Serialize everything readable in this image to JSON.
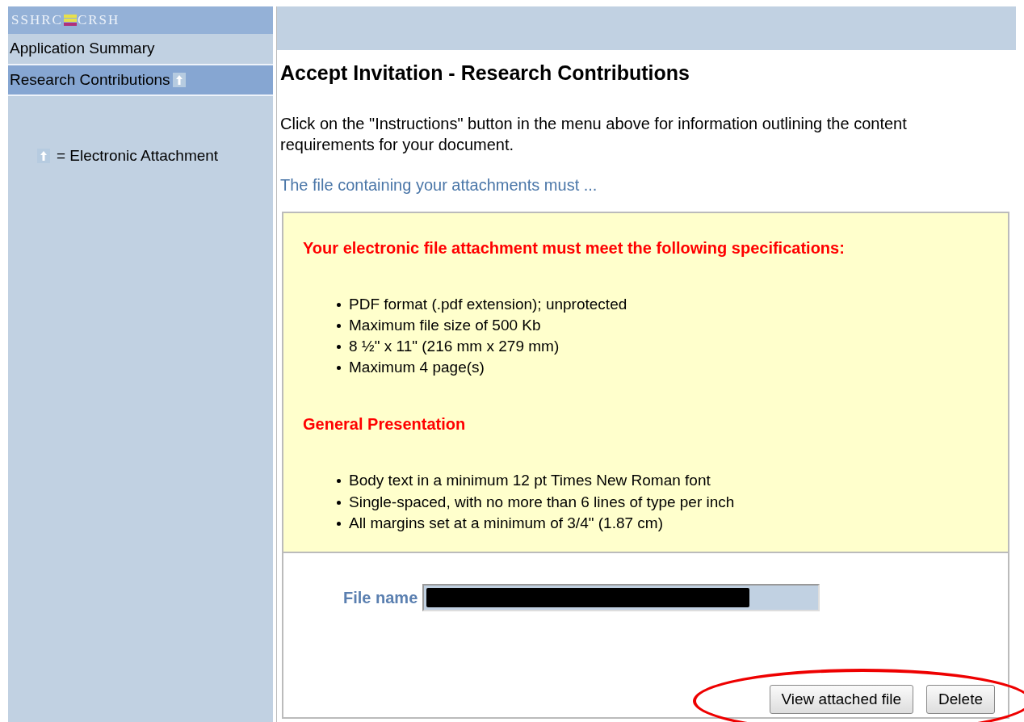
{
  "sidebar": {
    "logo": {
      "left": "SSHRC",
      "right": "CRSH"
    },
    "items": [
      {
        "label": "Application Summary",
        "selected": false,
        "attachment": false
      },
      {
        "label": "Research Contributions",
        "selected": true,
        "attachment": true
      }
    ],
    "legend": "= Electronic Attachment"
  },
  "main": {
    "title": "Accept Invitation - Research Contributions",
    "intro": "Click on the \"Instructions\" button in the menu above for information outlining the content requirements for your document.",
    "link": "The file containing your attachments must ...",
    "sections": [
      {
        "heading": "Your electronic file attachment must meet the following specifications:",
        "bullets": [
          "PDF format (.pdf extension); unprotected",
          "Maximum file size of 500 Kb",
          "8 ½\" x 11\" (216 mm x 279 mm)",
          "Maximum 4 page(s)"
        ]
      },
      {
        "heading": "General Presentation",
        "bullets": [
          "Body text in a minimum 12 pt Times New Roman font",
          "Single-spaced, with no more than 6 lines of type per inch",
          "All margins set at a minimum of 3/4\" (1.87 cm)"
        ]
      }
    ],
    "file_label": "File name",
    "file_redacted": true,
    "buttons": [
      "View attached file",
      "Delete"
    ],
    "highlight_buttons": true
  }
}
